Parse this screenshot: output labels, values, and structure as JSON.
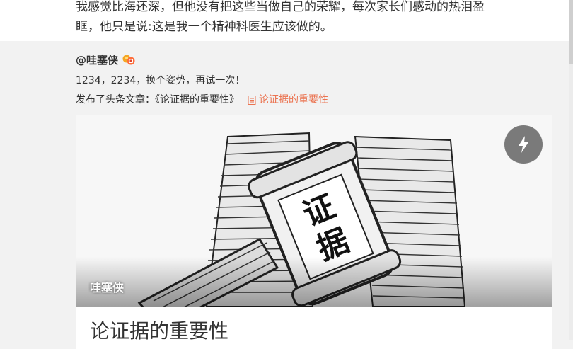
{
  "post": {
    "text_line1": "我感觉比海还深，但他没有把这些当做自己的荣耀，每次家长们感动的热泪盈",
    "text_line2": "眶，他只是说:这是我一个精神科医生应该做的。"
  },
  "retweet": {
    "author": "@哇塞侠",
    "text": "1234，2234，换个姿势，再试一次！",
    "article_prefix": "发布了头条文章：《论证据的重要性》",
    "article_link": "论证据的重要性",
    "link_color": "#eb7350",
    "card": {
      "cover_author": "哇塞侠",
      "cover_stamp_text": "证据",
      "title": "论证据的重要性",
      "flash_icon": "lightning-icon"
    }
  }
}
